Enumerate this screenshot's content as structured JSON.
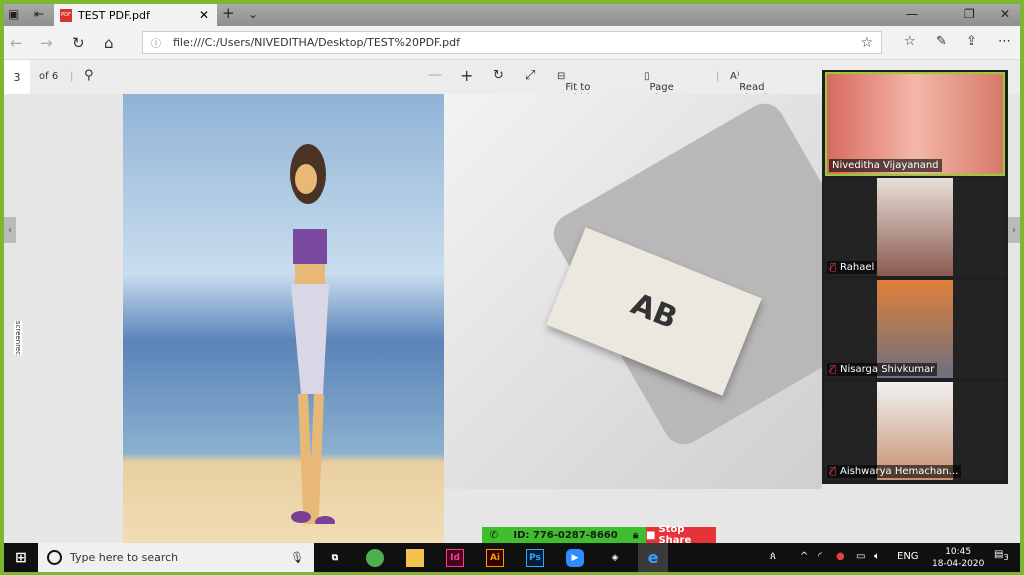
{
  "browser": {
    "tab_title": "TEST PDF.pdf",
    "url": "file:///C:/Users/NIVEDITHA/Desktop/TEST%20PDF.pdf"
  },
  "pdf_toolbar": {
    "page": "3",
    "of": "of 6",
    "fit_to_width": "Fit to width",
    "page_view": "Page view",
    "read_aloud": "Read aloud"
  },
  "pdf_content": {
    "card_logo": "AB"
  },
  "zoom": {
    "participants": [
      {
        "name": "Niveditha Vijayanand",
        "muted": false,
        "active": true
      },
      {
        "name": "Rahael",
        "muted": true
      },
      {
        "name": "Nisarga Shivkumar",
        "muted": true
      },
      {
        "name": "Aishwarya Hemachan...",
        "muted": true
      }
    ],
    "meeting_id": "ID: 776-0287-8660",
    "stop_share": "Stop Share",
    "accent": "#3fbf2e",
    "stop_color": "#e8323a"
  },
  "taskbar": {
    "search_placeholder": "Type here to search",
    "apps": [
      "Id",
      "Ai",
      "Ps"
    ],
    "lang": "ENG",
    "time": "10:45",
    "date": "18-04-2020",
    "notifications": "3"
  },
  "screenrec": "screenrec"
}
